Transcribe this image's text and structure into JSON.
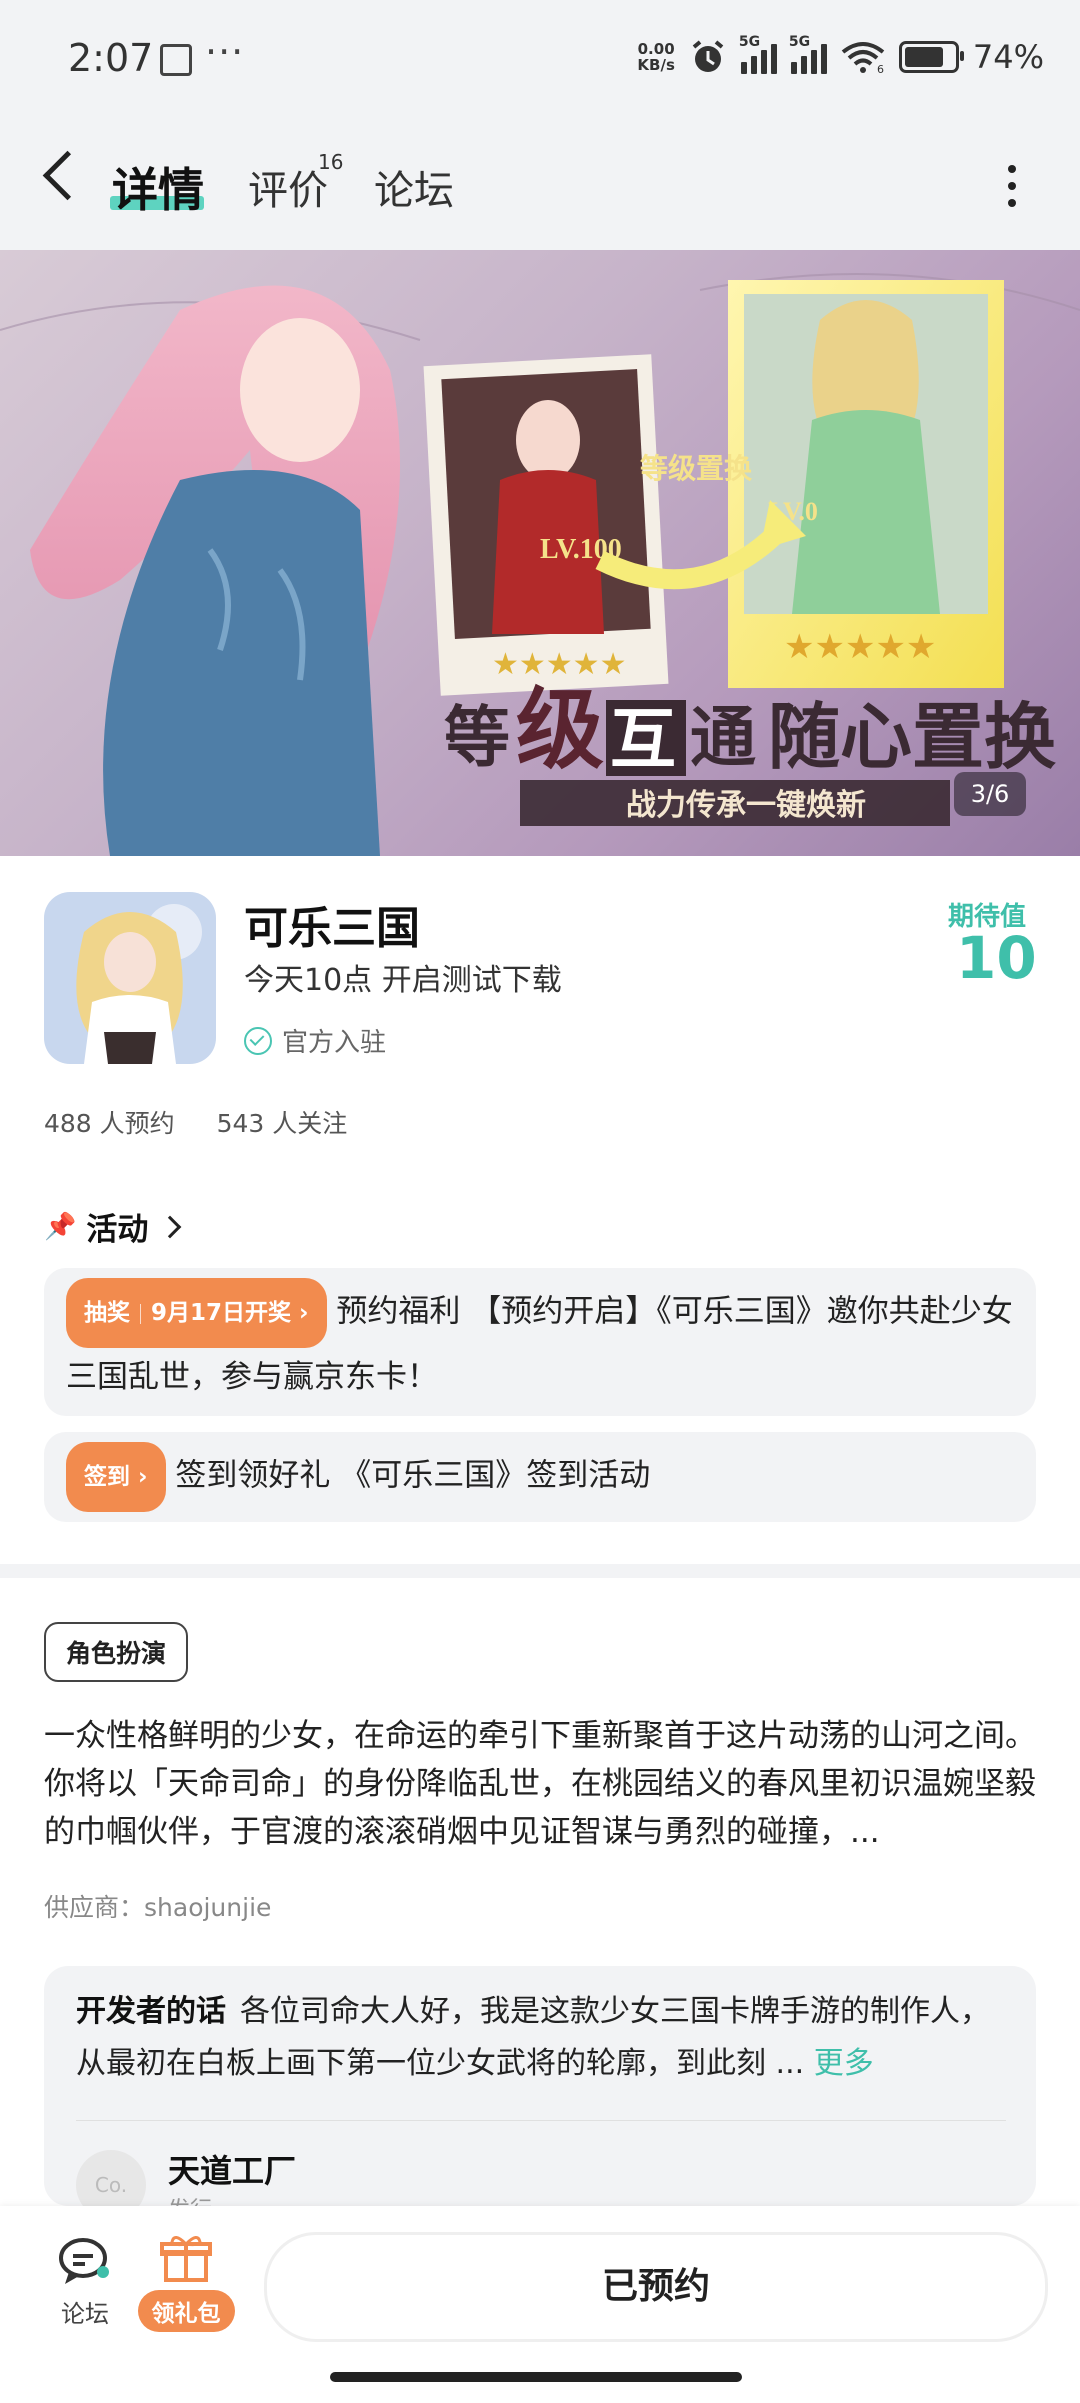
{
  "status_bar": {
    "time": "2:07",
    "speed_top": "0.00",
    "speed_unit": "KB/s",
    "network1": "5G",
    "network2": "5G",
    "wifi_num": "6",
    "battery": "74%"
  },
  "nav": {
    "tabs": [
      {
        "label": "详情"
      },
      {
        "label": "评价"
      },
      {
        "label": "论坛"
      }
    ],
    "review_count": "16"
  },
  "banner": {
    "counter": "3/6",
    "title_parts": [
      "等",
      "级",
      "互",
      "通",
      "随心置换"
    ],
    "subtitle": "战力传承一键焕新",
    "swap_label": "等级置换",
    "left_level": "LV.100",
    "right_level": "LV.0"
  },
  "app": {
    "name": "可乐三国",
    "subtitle": "今天10点 开启测试下载",
    "official": "官方入驻",
    "expect_label": "期待值",
    "expect_value": "10",
    "reservations": "488 人预约",
    "followers": "543 人关注"
  },
  "activities": {
    "header": "活动",
    "items": [
      {
        "pill_type": "抽奖",
        "pill_date": "9月17日开奖",
        "text": "预约福利 【预约开启】《可乐三国》邀你共赴少女三国乱世，参与赢京东卡！"
      },
      {
        "pill_type": "签到",
        "text": "签到领好礼 《可乐三国》签到活动"
      }
    ]
  },
  "genre": "角色扮演",
  "description": "一众性格鲜明的少女，在命运的牵引下重新聚首于这片动荡的山河之间。你将以「天命司命」的身份降临乱世，在桃园结义的春风里初识温婉坚毅的巾帼伙伴，于官渡的滚滚硝烟中见证智谋与勇烈的碰撞，...",
  "supplier": "供应商：shaojunjie",
  "developer": {
    "label": "开发者的话",
    "text": "各位司命大人好，我是这款少女三国卡牌手游的制作人，从最初在白板上画下第一位少女武将的轮廓，到此刻 ...",
    "more": "更多",
    "avatar_text": "Co.",
    "name": "天道工厂",
    "role": "发行"
  },
  "bottom": {
    "forum": "论坛",
    "gift": "领礼包",
    "reserved": "已预约"
  },
  "colors": {
    "accent": "#3fbfaa",
    "orange": "#f28b4e",
    "tab_underline": "#5ed3c0"
  }
}
